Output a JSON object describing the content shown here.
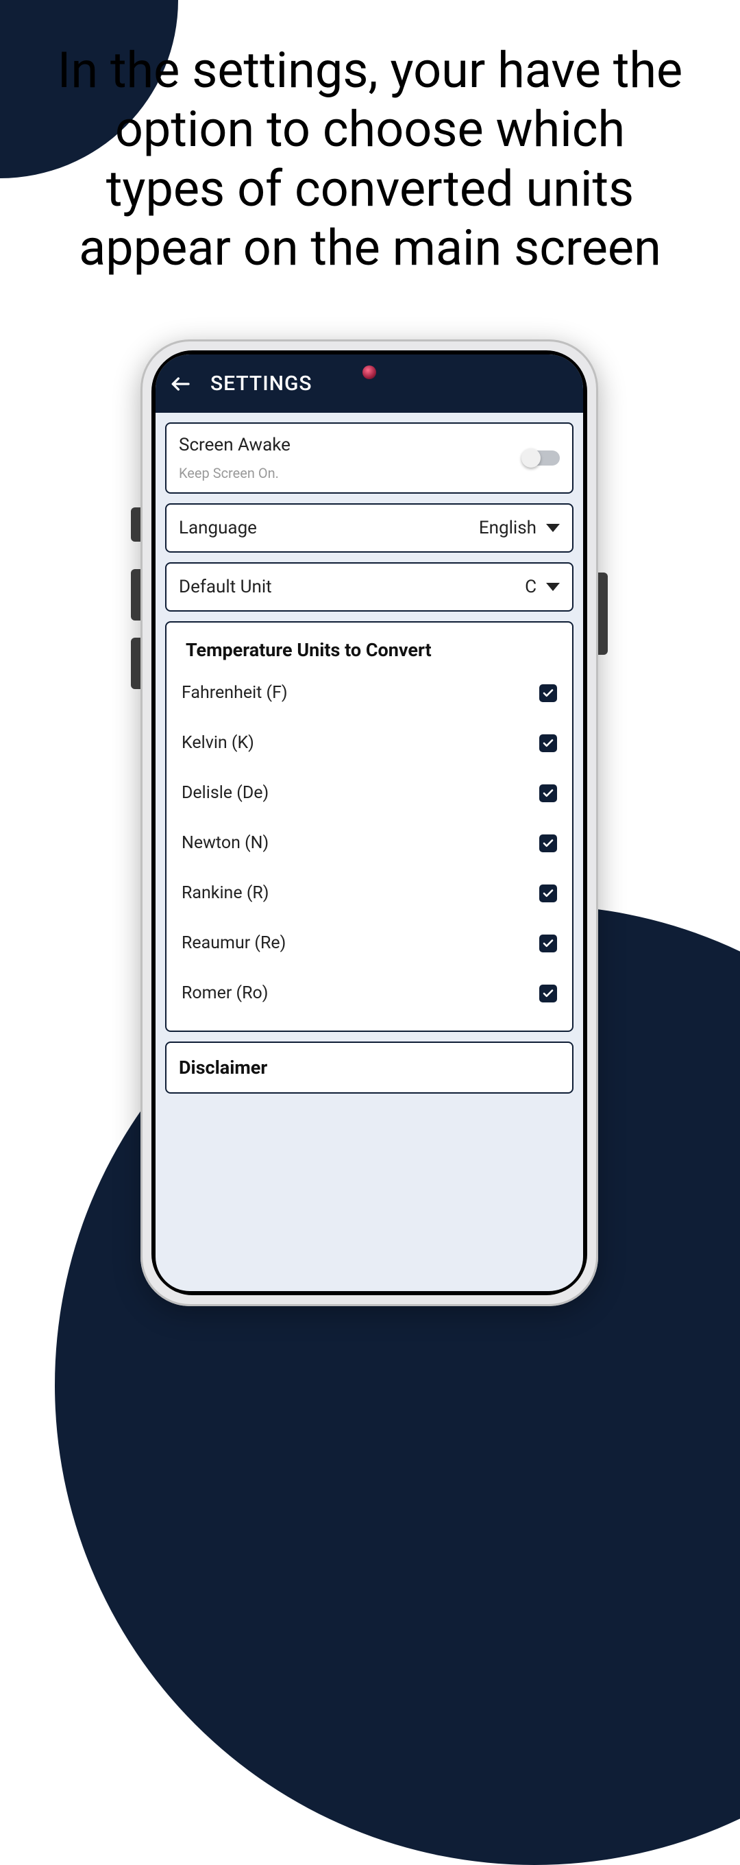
{
  "headline": "In the settings, your have the option to choose which types of converted units appear on the main screen",
  "appbar": {
    "title": "SETTINGS"
  },
  "screen_awake": {
    "title": "Screen Awake",
    "subtitle": "Keep Screen On.",
    "enabled": false
  },
  "language": {
    "label": "Language",
    "value": "English"
  },
  "default_unit": {
    "label": "Default Unit",
    "value": "C"
  },
  "units_section": {
    "title": "Temperature Units to Convert",
    "items": [
      {
        "label": "Fahrenheit (F)",
        "checked": true
      },
      {
        "label": "Kelvin (K)",
        "checked": true
      },
      {
        "label": "Delisle (De)",
        "checked": true
      },
      {
        "label": "Newton (N)",
        "checked": true
      },
      {
        "label": "Rankine (R)",
        "checked": true
      },
      {
        "label": "Reaumur (Re)",
        "checked": true
      },
      {
        "label": "Romer (Ro)",
        "checked": true
      }
    ]
  },
  "disclaimer": {
    "title": "Disclaimer"
  }
}
